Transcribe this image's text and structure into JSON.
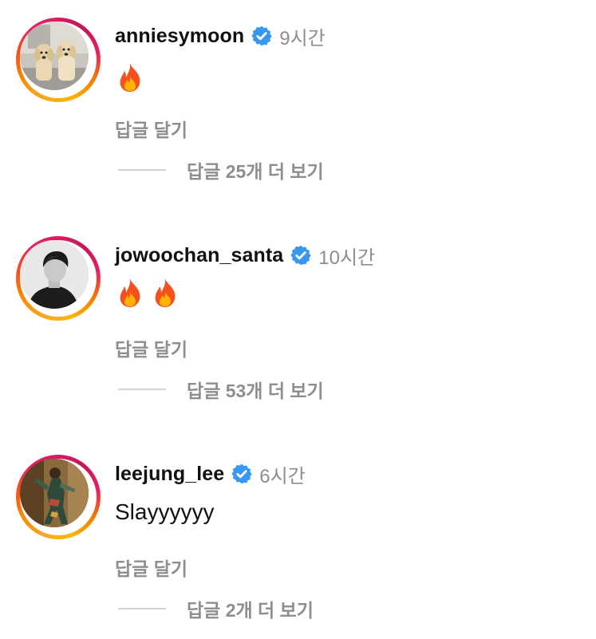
{
  "comments": [
    {
      "username": "anniesymoon",
      "verified": true,
      "time": "9시간",
      "text": "",
      "emoji": [
        "fire"
      ],
      "reply_label": "답글 달기",
      "more_replies": "답글 25개 더 보기",
      "avatar": "two-dogs-photo"
    },
    {
      "username": "jowoochan_santa",
      "verified": true,
      "time": "10시간",
      "text": "",
      "emoji": [
        "fire",
        "fire"
      ],
      "reply_label": "답글 달기",
      "more_replies": "답글 53개 더 보기",
      "avatar": "bw-portrait-photo"
    },
    {
      "username": "leejung_lee",
      "verified": true,
      "time": "6시간",
      "text": "Slayyyyyy",
      "emoji": [],
      "reply_label": "답글 달기",
      "more_replies": "답글 2개 더 보기",
      "avatar": "dancer-photo"
    }
  ],
  "colors": {
    "verified_blue": "#3897f0",
    "muted_text": "#8e8e8e",
    "story_ring_start": "#f9a825",
    "story_ring_end": "#d81b60"
  }
}
